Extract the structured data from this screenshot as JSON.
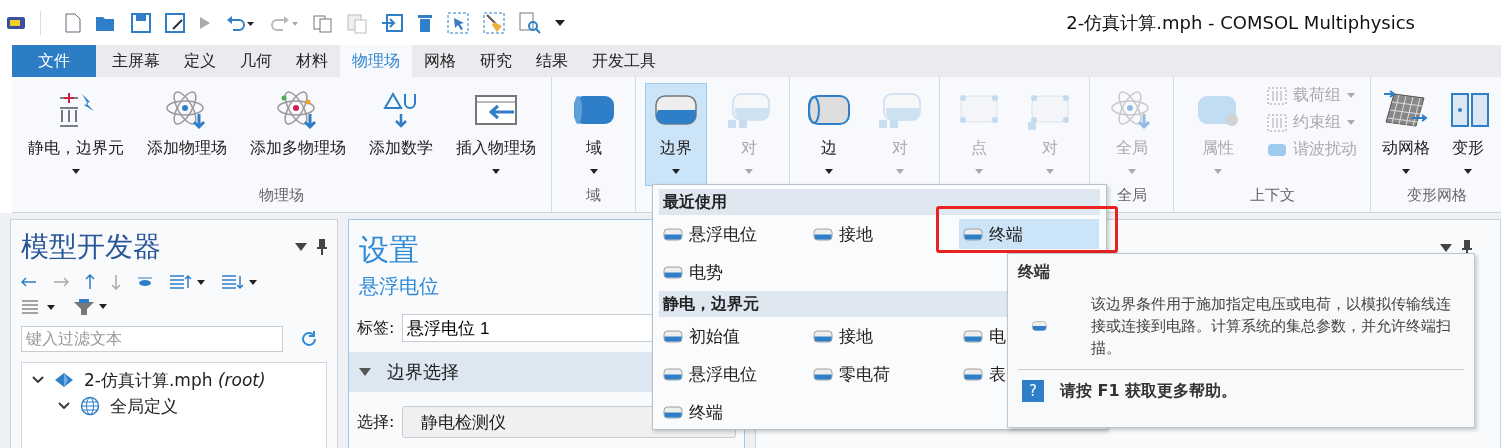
{
  "window": {
    "title": "2-仿真计算.mph - COMSOL Multiphysics"
  },
  "tabs": [
    {
      "label": "文件",
      "kind": "file",
      "selected": false
    },
    {
      "label": "主屏幕",
      "kind": "tab",
      "selected": false
    },
    {
      "label": "定义",
      "kind": "tab",
      "selected": false
    },
    {
      "label": "几何",
      "kind": "tab",
      "selected": false
    },
    {
      "label": "材料",
      "kind": "tab",
      "selected": false
    },
    {
      "label": "物理场",
      "kind": "tab",
      "selected": true
    },
    {
      "label": "网格",
      "kind": "tab",
      "selected": false
    },
    {
      "label": "研究",
      "kind": "tab",
      "selected": false
    },
    {
      "label": "结果",
      "kind": "tab",
      "selected": false
    },
    {
      "label": "开发工具",
      "kind": "tab",
      "selected": false
    }
  ],
  "ribbon": {
    "groups": [
      {
        "label": "物理场",
        "buttons": [
          {
            "label": "静电，边界元",
            "kind": "electrostatics",
            "dropdown": true,
            "disabled": false,
            "selected": false
          },
          {
            "label": "添加物理场",
            "kind": "atom",
            "dropdown": false,
            "disabled": false,
            "selected": false
          },
          {
            "label": "添加多物理场",
            "kind": "atom-multi",
            "dropdown": false,
            "disabled": false,
            "selected": false
          },
          {
            "label": "添加数学",
            "kind": "math",
            "dropdown": false,
            "disabled": false,
            "selected": false
          },
          {
            "label": "插入物理场",
            "kind": "insert",
            "dropdown": true,
            "disabled": false,
            "selected": false
          }
        ]
      },
      {
        "label": "域",
        "buttons": [
          {
            "label": "域",
            "kind": "domain",
            "dropdown": true,
            "disabled": false,
            "selected": false
          }
        ]
      },
      {
        "buttons": [
          {
            "label": "边界",
            "kind": "boundary",
            "dropdown": true,
            "disabled": false,
            "selected": true
          },
          {
            "label": "对",
            "kind": "pair",
            "dropdown": true,
            "disabled": true,
            "selected": false
          }
        ]
      },
      {
        "buttons": [
          {
            "label": "边",
            "kind": "edge",
            "dropdown": true,
            "disabled": false,
            "selected": false
          },
          {
            "label": "对",
            "kind": "pair",
            "dropdown": true,
            "disabled": true,
            "selected": false
          }
        ]
      },
      {
        "buttons": [
          {
            "label": "点",
            "kind": "point",
            "dropdown": true,
            "disabled": true,
            "selected": false
          },
          {
            "label": "对",
            "kind": "point-pair",
            "dropdown": true,
            "disabled": true,
            "selected": false
          }
        ]
      },
      {
        "label": "全局",
        "buttons": [
          {
            "label": "全局",
            "kind": "atom",
            "dropdown": true,
            "disabled": true,
            "selected": false
          }
        ]
      },
      {
        "label": "上下文",
        "buttons": [
          {
            "label": "属性",
            "kind": "property",
            "dropdown": true,
            "disabled": true,
            "selected": false
          }
        ],
        "small_buttons": [
          {
            "label": "载荷组",
            "kind": "load",
            "dropdown": true,
            "disabled": true
          },
          {
            "label": "约束组",
            "kind": "load",
            "dropdown": true,
            "disabled": true
          },
          {
            "label": "谐波扰动",
            "kind": "cylinder",
            "dropdown": false,
            "disabled": true
          }
        ]
      },
      {
        "label": "变形网格",
        "buttons": [
          {
            "label": "动网格",
            "kind": "mesh",
            "dropdown": true,
            "disabled": false,
            "selected": false
          },
          {
            "label": "变形",
            "kind": "deform",
            "dropdown": true,
            "disabled": false,
            "selected": false
          }
        ]
      }
    ]
  },
  "model_builder": {
    "title": "模型开发器",
    "filter": {
      "placeholder": "键入过滤文本"
    },
    "tree": [
      {
        "label": "2-仿真计算.mph *(root)*",
        "kind": "model",
        "expanded": true,
        "children": [
          {
            "label": "全局定义",
            "kind": "globe",
            "expanded": true
          }
        ]
      }
    ]
  },
  "settings": {
    "title": "设置",
    "subtitle": "悬浮电位",
    "label_caption": "标签:",
    "label_value": "悬浮电位 1",
    "section": {
      "title": "边界选择",
      "expanded": true
    },
    "selection_caption": "选择:",
    "selection_value": "静电检测仪"
  },
  "boundary_menu": {
    "sections": [
      {
        "title": "最近使用",
        "items": [
          {
            "label": "悬浮电位",
            "selected": false
          },
          {
            "label": "接地",
            "selected": false
          },
          {
            "label": "终端",
            "selected": true
          },
          {
            "label": "电势",
            "selected": false
          }
        ]
      },
      {
        "title": "静电，边界元",
        "items": [
          {
            "label": "初始值",
            "selected": false
          },
          {
            "label": "接地",
            "selected": false
          },
          {
            "label": "电",
            "selected": false
          },
          {
            "label": "悬浮电位",
            "selected": false
          },
          {
            "label": "零电荷",
            "selected": false
          },
          {
            "label": "表",
            "selected": false
          },
          {
            "label": "终端",
            "selected": false
          }
        ]
      }
    ]
  },
  "tooltip": {
    "title": "终端",
    "text": "该边界条件用于施加指定电压或电荷，以模拟传输线连接或连接到电路。计算系统的集总参数，并允许终端扫描。",
    "help_icon": "?",
    "help": "请按 F1 获取更多帮助。"
  }
}
